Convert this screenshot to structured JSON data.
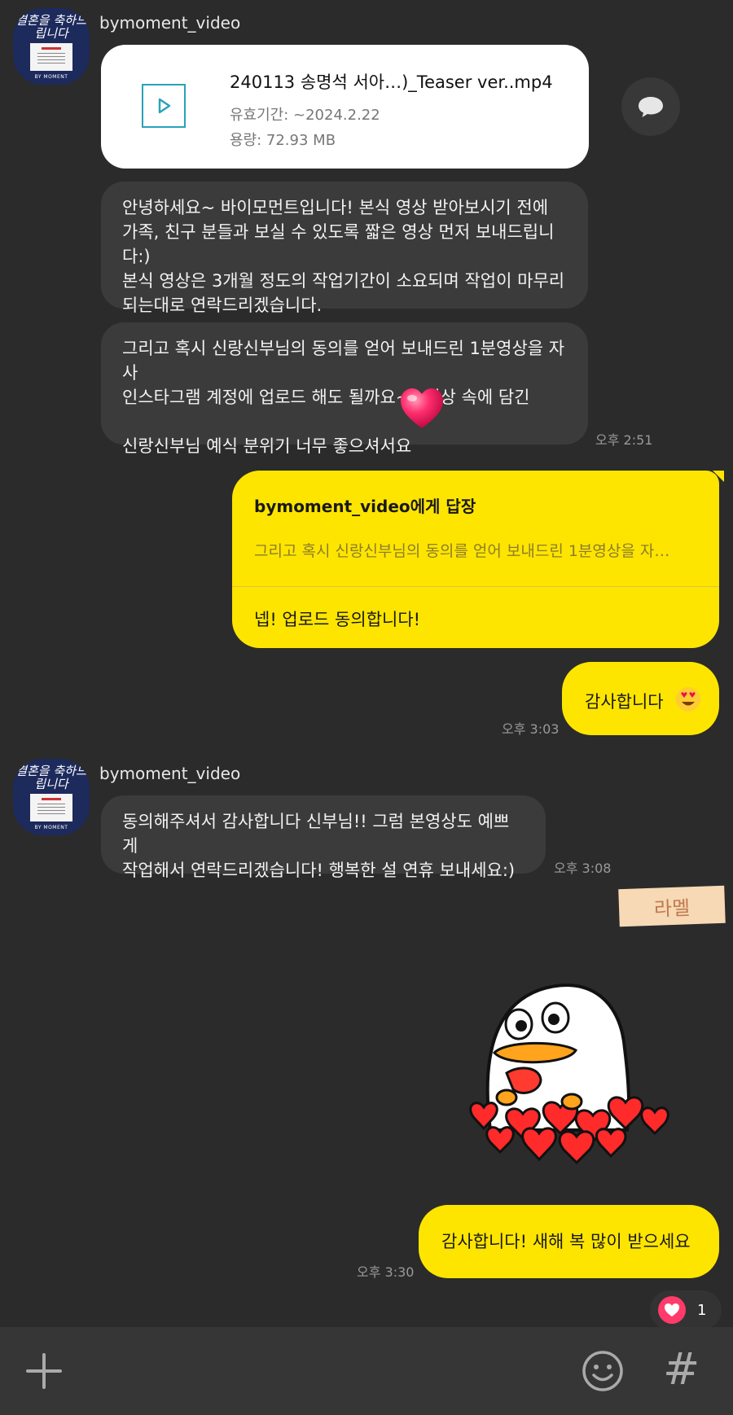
{
  "messages": {
    "sender_name": "bymoment_video",
    "file": {
      "name": "240113 송명석 서아…)_Teaser ver..mp4",
      "expiry": "유효기간: ~2024.2.22",
      "size": "용량: 72.93 MB"
    },
    "msg1": "안녕하세요~ 바이모먼트입니다! 본식 영상 받아보시기 전에\n가족, 친구 분들과 보실 수 있도록 짧은 영상 먼저 보내드립니다:)\n본식 영상은 3개월 정도의 작업기간이 소요되며 작업이 마무리\n되는대로 연락드리겠습니다.",
    "msg2": "그리고 혹시 신랑신부님의 동의를 얻어 보내드린 1분영상을 자사\n인스타그램 계정에 업로드 해도 될까요~? 영상 속에 담긴\n\n신랑신부님 예식 분위기 너무 좋으셔서요",
    "time1": "오후 2:51",
    "reply": {
      "to": "bymoment_video에게 답장",
      "quote": "그리고 혹시 신랑신부님의 동의를 얻어 보내드린 1분영상을 자…",
      "text": "넵! 업로드 동의합니다!"
    },
    "thanks": "감사합니다",
    "time2": "오후 3:03",
    "msg3": "동의해주셔서 감사합니다 신부님!! 그럼 본영상도 예쁘게\n작업해서 연락드리겠습니다! 행복한 설 연휴 보내세요:)",
    "time3": "오후 3:08",
    "sticker_label": "라멜",
    "final": "감사합니다! 새해 복 많이 받으세요",
    "time4": "오후 3:30",
    "reaction_count": "1"
  },
  "avatar": {
    "script_text": "결혼을 축하드립니다",
    "brand": "BY MOMENT"
  },
  "colors": {
    "background": "#2b2b2b",
    "incoming_bubble": "#3b3b3b",
    "outgoing_bubble": "#fee500",
    "reaction_heart": "#ff3b6b"
  },
  "icons": [
    "play-icon",
    "speech-bubble-icon",
    "heart-eyes-emoji",
    "heart-emoji",
    "plus-icon",
    "smiley-icon",
    "hash-icon"
  ]
}
